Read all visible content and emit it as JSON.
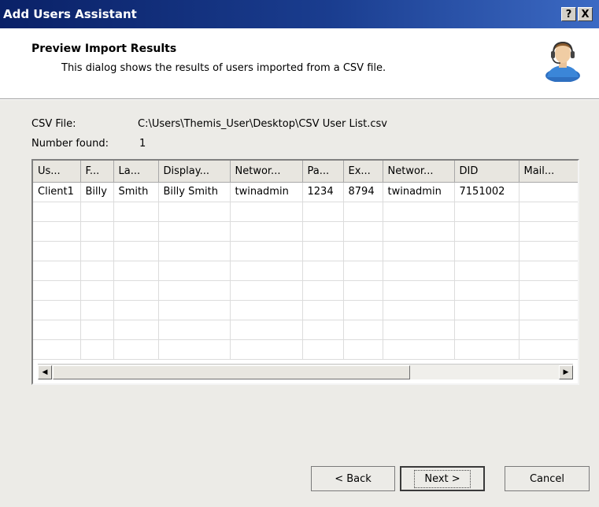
{
  "window": {
    "title": "Add Users Assistant",
    "help_glyph": "?",
    "close_glyph": "X"
  },
  "header": {
    "title": "Preview Import Results",
    "subtitle": "This dialog shows the results of users imported from a CSV file.",
    "icon": "user-headset-icon"
  },
  "info": {
    "csv_label": "CSV File:",
    "csv_value": "C:\\Users\\Themis_User\\Desktop\\CSV User List.csv",
    "number_label": "Number found:",
    "number_value": "1"
  },
  "grid": {
    "columns": [
      "Us...",
      "F...",
      "La...",
      "Display...",
      "Networ...",
      "Pa...",
      "Ex...",
      "Networ...",
      "DID",
      "Mail..."
    ],
    "rows": [
      [
        "Client1",
        "Billy",
        "Smith",
        "Billy Smith",
        "twinadmin",
        "1234",
        "8794",
        "twinadmin",
        "7151002",
        ""
      ]
    ],
    "empty_rows": 8
  },
  "buttons": {
    "back": "< Back",
    "next": "Next >",
    "cancel": "Cancel"
  }
}
